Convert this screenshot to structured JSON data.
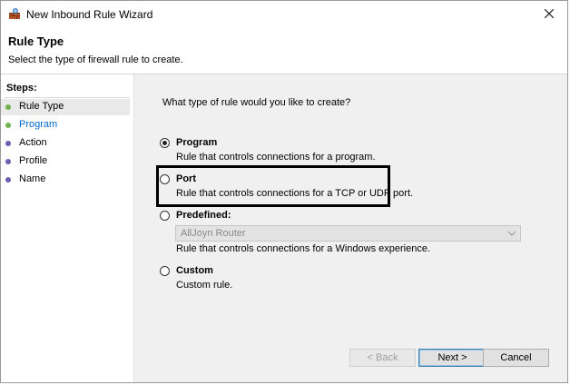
{
  "window": {
    "title": "New Inbound Rule Wizard",
    "icon": "firewall-icon"
  },
  "header": {
    "title": "Rule Type",
    "subtitle": "Select the type of firewall rule to create."
  },
  "steps": {
    "heading": "Steps:",
    "items": [
      {
        "label": "Rule Type",
        "dot_color": "#6fb24e"
      },
      {
        "label": "Program",
        "dot_color": "#6fb24e"
      },
      {
        "label": "Action",
        "dot_color": "#6a5fb0"
      },
      {
        "label": "Profile",
        "dot_color": "#6a5fb0"
      },
      {
        "label": "Name",
        "dot_color": "#6a5fb0"
      }
    ]
  },
  "main": {
    "question": "What type of rule would you like to create?",
    "options": [
      {
        "title": "Program",
        "description": "Rule that controls connections for a program.",
        "checked": true
      },
      {
        "title": "Port",
        "description": "Rule that controls connections for a TCP or UDP port.",
        "checked": false
      },
      {
        "title": "Predefined:",
        "description": "Rule that controls connections for a Windows experience.",
        "checked": false
      },
      {
        "title": "Custom",
        "description": "Custom rule.",
        "checked": false
      }
    ],
    "predefined_selected": "AllJoyn Router"
  },
  "buttons": {
    "back": "< Back",
    "next": "Next >",
    "cancel": "Cancel"
  },
  "colors": {
    "link_blue": "#0066cc",
    "panel_bg": "#f0f0f0"
  }
}
